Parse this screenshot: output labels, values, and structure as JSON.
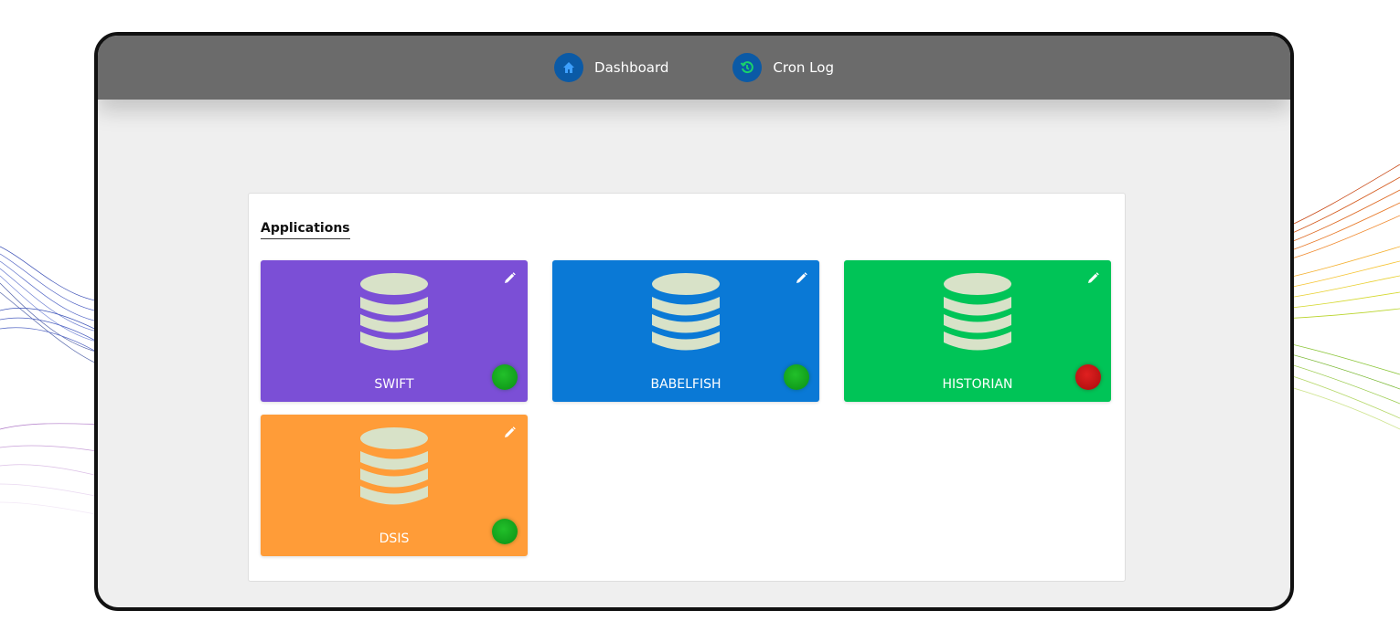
{
  "nav": {
    "items": [
      {
        "label": "Dashboard",
        "icon": "home-icon"
      },
      {
        "label": "Cron Log",
        "icon": "history-icon"
      }
    ]
  },
  "panel": {
    "title": "Applications"
  },
  "applications": [
    {
      "name": "SWIFT",
      "color": "#7b4fd6",
      "status": "online"
    },
    {
      "name": "BABELFISH",
      "color": "#0a79d6",
      "status": "online"
    },
    {
      "name": "HISTORIAN",
      "color": "#00c457",
      "status": "offline"
    },
    {
      "name": "DSIS",
      "color": "#ff9c38",
      "status": "online"
    }
  ],
  "colors": {
    "topbar": "#6b6b6b",
    "status_online": "#13a81d",
    "status_offline": "#d01818",
    "icon_fill": "#d8e2c8"
  }
}
